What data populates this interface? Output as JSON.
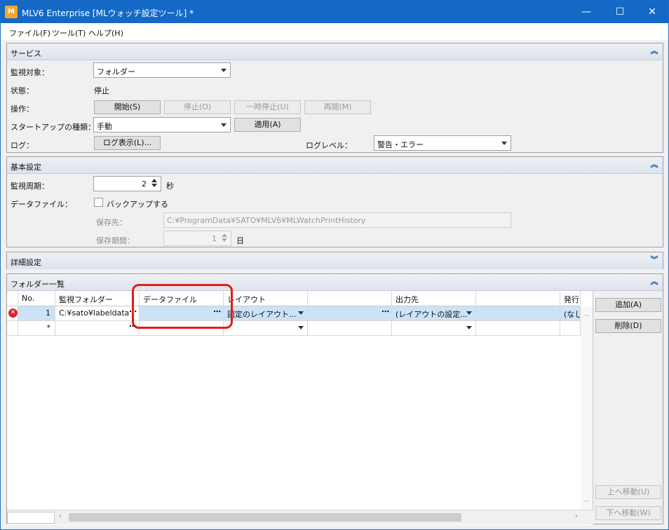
{
  "window": {
    "icon_text": "M",
    "title": "MLV6 Enterprise [MLウォッチ設定ツール] *",
    "controls": {
      "minimize": "—",
      "maximize": "☐",
      "close": "✕"
    }
  },
  "menu": {
    "items": [
      "ファイル(F)",
      "ツール(T)",
      "ヘルプ(H)"
    ]
  },
  "service": {
    "title": "サービス",
    "monitor_target_label": "監視対象：",
    "monitor_target_value": "フォルダー",
    "status_label": "状態：",
    "status_value": "停止",
    "operation_label": "操作：",
    "start_button": "開始(S)",
    "stop_button": "停止(O)",
    "pause_button": "一時停止(U)",
    "resume_button": "再開(M)",
    "startup_label": "スタートアップの種類：",
    "startup_value": "手動",
    "apply_button": "適用(A)",
    "log_label": "ログ：",
    "log_button": "ログ表示(L)...",
    "loglevel_label": "ログレベル：",
    "loglevel_value": "警告・エラー"
  },
  "basic": {
    "title": "基本設定",
    "interval_label": "監視周期：",
    "interval_value": "2",
    "interval_unit": "秒",
    "datafile_label": "データファイル：",
    "backup_label": "バックアップする",
    "backup_checked": false,
    "dest_label": "保存先：",
    "dest_value": "C:¥ProgramData¥SATO¥MLV6¥MLWatchPrintHistory",
    "period_label": "保存期間：",
    "period_value": "1",
    "period_unit": "日"
  },
  "detail": {
    "title": "詳細設定"
  },
  "folders": {
    "title": "フォルダー一覧",
    "columns": [
      "No.",
      "監視フォルダー",
      "データファイル",
      "レイアウト",
      "",
      "出力先",
      "",
      "発行"
    ],
    "rows": [
      {
        "no": "1",
        "folder": "C:¥sato¥labeldata",
        "datafile": "",
        "layout": "固定のレイアウト...",
        "output": "(レイアウトの設定...",
        "issue": "(なし"
      },
      {
        "no": "*",
        "folder": "",
        "datafile": "",
        "layout": "",
        "output": "",
        "issue": ""
      }
    ],
    "add_button": "追加(A)",
    "delete_button": "削除(D)",
    "up_button": "上へ移動(U)",
    "down_button": "下へ移動(W)"
  }
}
